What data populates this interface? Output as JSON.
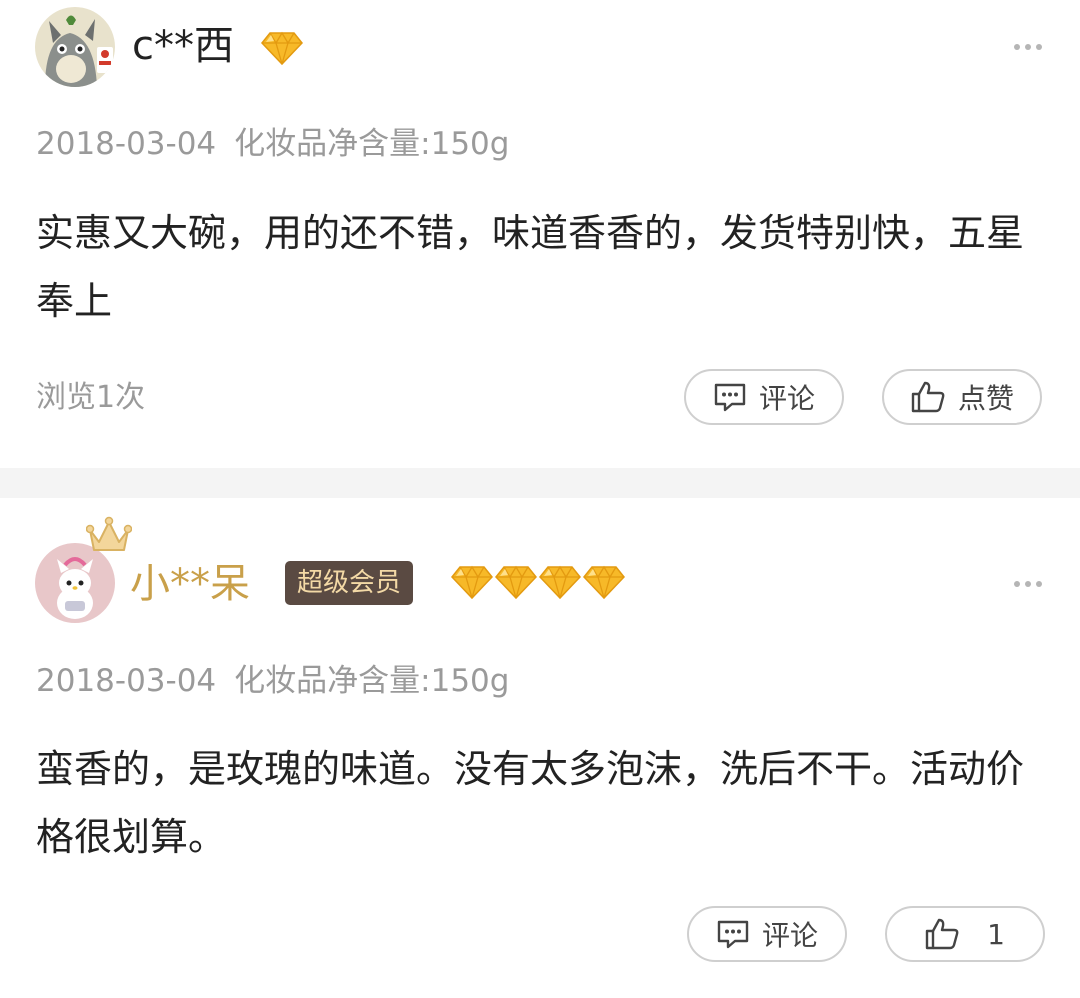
{
  "reviews": [
    {
      "username": "c**西",
      "vip_label": "",
      "diamond_count": 1,
      "date": "2018-03-04",
      "spec": "化妆品净含量:150g",
      "content": "实惠又大碗，用的还不错，味道香香的，发货特别快，五星奉上",
      "views": "浏览1次",
      "comment_label": "评论",
      "like_label": "点赞",
      "username_color": "#222222"
    },
    {
      "username": "小**呆",
      "vip_label": "超级会员",
      "diamond_count": 4,
      "date": "2018-03-04",
      "spec": "化妆品净含量:150g",
      "content": "蛮香的，是玫瑰的味道。没有太多泡沫，洗后不干。活动价格很划算。",
      "comment_label": "评论",
      "like_label": "1",
      "username_color": "#c9a04a"
    }
  ],
  "colors": {
    "diamond": "#f7b928",
    "vip_badge_bg": "#5a4a42",
    "vip_badge_text": "#f3d9a6",
    "meta_text": "#9a9a9a",
    "divider": "#f4f4f4"
  },
  "icons": {
    "more": "more-dots-icon",
    "comment": "comment-icon",
    "like": "thumbs-up-icon",
    "diamond": "diamond-icon",
    "crown": "crown-icon"
  }
}
